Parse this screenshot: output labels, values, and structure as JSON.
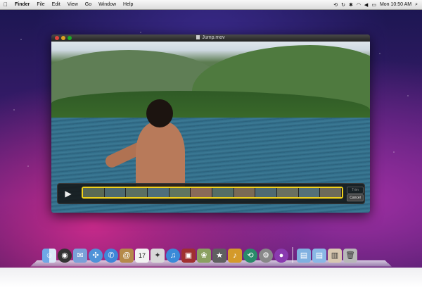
{
  "menubar": {
    "apple": "",
    "items": [
      "Finder",
      "File",
      "Edit",
      "View",
      "Go",
      "Window",
      "Help"
    ],
    "clock": "Mon 10:50 AM"
  },
  "window": {
    "title": "Jump.mov"
  },
  "controls": {
    "play_icon": "▶",
    "trim_label": "Trim",
    "cancel_label": "Cancel"
  },
  "dock": {
    "items": [
      "finder",
      "dashboard",
      "mail-stamp",
      "safari",
      "ichat",
      "address-book",
      "ical",
      "preview",
      "itunes",
      "photo-booth",
      "iphoto",
      "imovie",
      "garageband",
      "time-machine",
      "system-preferences",
      "front-row"
    ],
    "calendar_day": "17",
    "stacks": [
      "applications-folder",
      "documents-folder",
      "downloads-stack",
      "trash"
    ]
  },
  "colors": {
    "accent_trim": "#f2d21a"
  }
}
